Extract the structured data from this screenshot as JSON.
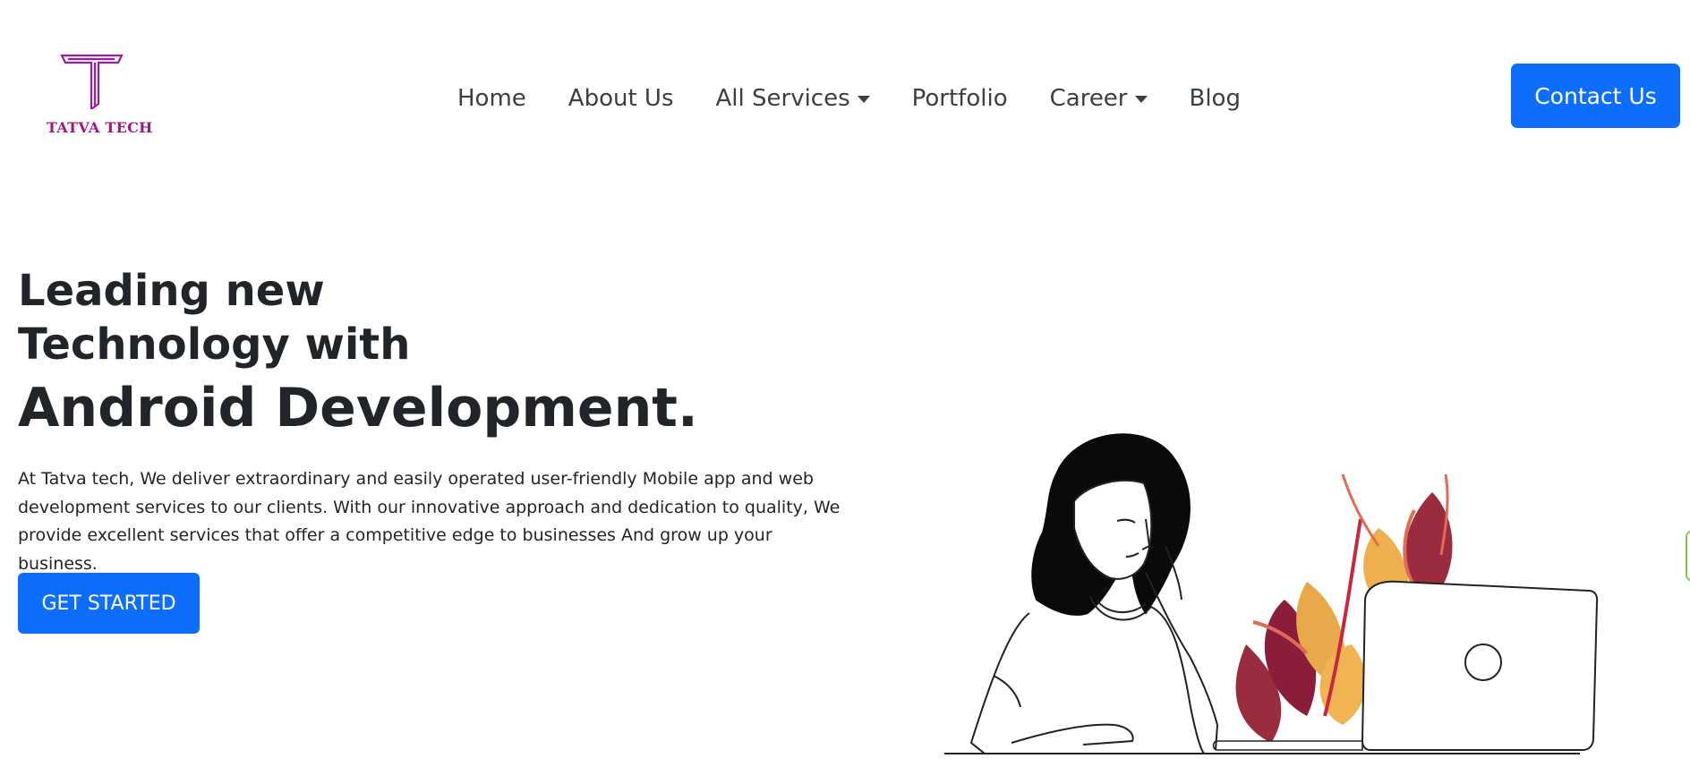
{
  "brand": {
    "name": "TATVA TECH",
    "logo_color": "#a2167f"
  },
  "nav": {
    "items": [
      {
        "label": "Home",
        "has_dropdown": false
      },
      {
        "label": "About Us",
        "has_dropdown": false
      },
      {
        "label": "All Services",
        "has_dropdown": true
      },
      {
        "label": "Portfolio",
        "has_dropdown": false
      },
      {
        "label": "Career",
        "has_dropdown": true
      },
      {
        "label": "Blog",
        "has_dropdown": false
      }
    ],
    "contact_label": "Contact Us"
  },
  "hero": {
    "title_line1": "Leading new",
    "title_line2": "Technology with",
    "title_line3": "Android Development.",
    "description": "At Tatva tech, We deliver extraordinary and easily operated user-friendly Mobile app and web development services to our clients. With our innovative approach and dedication to quality, We provide excellent services that offer a competitive edge to businesses And grow up your business.",
    "cta_label": "GET STARTED"
  },
  "colors": {
    "primary": "#0d6efd",
    "text": "#212529",
    "nav_text": "#3a3f44"
  }
}
